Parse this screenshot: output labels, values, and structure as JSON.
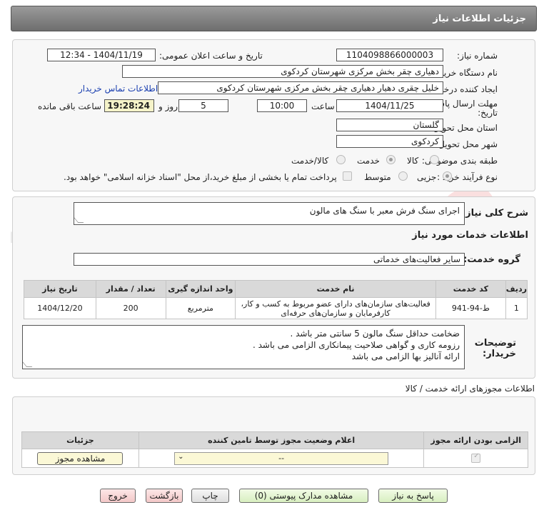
{
  "header": {
    "title": "جزئیات اطلاعات نیاز"
  },
  "form": {
    "need_number_label": "شماره نیاز:",
    "need_number": "1104098866000003",
    "announce_label": "تاریخ و ساعت اعلان عمومی:",
    "announce_value": "1404/11/19 - 12:34",
    "buyer_org_label": "نام دستگاه خریدار:",
    "buyer_org": "دهیاری چقر بخش مرکزی شهرستان کردکوی",
    "requester_label": "ایجاد کننده درخواست:",
    "requester": "خلیل چقری دهیار دهیاری چقر بخش مرکزی شهرستان کردکوی",
    "contact_link": "اطلاعات تماس خریدار",
    "deadline_label_1": "مهلت ارسال پاسخ: تا",
    "deadline_label_2": "تاریخ:",
    "deadline_date": "1404/11/25",
    "time_label": "ساعت",
    "deadline_time": "10:00",
    "days_value": "5",
    "days_label": "روز و",
    "remaining_time": "19:28:24",
    "remaining_label": "ساعت باقی مانده",
    "province_label": "استان محل تحویل:",
    "province": "گلستان",
    "city_label": "شهر محل تحویل:",
    "city": "کردکوی",
    "category_label": "طبقه بندی موضوعی:",
    "category_options": [
      "کالا",
      "خدمت",
      "کالا/خدمت"
    ],
    "category_selected": "خدمت",
    "process_label": "نوع فرآیند خرید :",
    "process_options": [
      "جزیی",
      "متوسط"
    ],
    "treasury_text": "پرداخت تمام یا بخشی از مبلغ خرید،از محل \"اسناد خزانه اسلامی\" خواهد بود."
  },
  "need": {
    "summary_label": "شرح کلی نیاز:",
    "summary": "اجرای سنگ فرش معبر با سنگ های مالون",
    "services_title": "اطلاعات خدمات مورد نیاز",
    "service_group_label": "گروه خدمت:",
    "service_group": "سایر فعالیت‌های خدماتی",
    "table": {
      "headers": [
        "ردیف",
        "کد خدمت",
        "نام خدمت",
        "واحد اندازه گیری",
        "تعداد / مقدار",
        "تاریخ نیاز"
      ],
      "rows": [
        [
          "1",
          "ط-94-941",
          "فعالیت‌های سازمان‌های دارای عضو مربوط به کسب و کار، کارفرمایان و سازمان‌های حرفه‌ای",
          "مترمربع",
          "200",
          "1404/12/20"
        ]
      ]
    },
    "buyer_notes_label_1": "توضیحات",
    "buyer_notes_label_2": "خریدار:",
    "buyer_notes": [
      "ضخامت حداقل سنگ مالون 5 سانتی متر باشد .",
      "رزومه کاری و گواهی صلاحیت پیمانکاری الزامی می باشد .",
      "ارائه آنالیز بها الزامی می باشد"
    ]
  },
  "permits": {
    "title": "اطلاعات مجوزهای ارائه خدمت / کالا",
    "headers": [
      "الزامی بودن ارائه مجوز",
      "اعلام وضعیت مجوز توسط تامین کننده",
      "جزئیات"
    ],
    "select_value": "--",
    "view_button": "مشاهده مجوز"
  },
  "buttons": {
    "reply": "پاسخ به نیاز",
    "view_docs": "مشاهده مدارک پیوستی (0)",
    "print": "چاپ",
    "back": "بازگشت",
    "exit": "خروج"
  },
  "watermark": {
    "text": "AriaTender.net"
  },
  "colors": {
    "header_bg": "#7f7f7f",
    "link": "#1a3fb0",
    "remaining_bg": "#f5f3c9",
    "reply_button": "#d8efc0",
    "exit_button": "#f3c8c8"
  }
}
